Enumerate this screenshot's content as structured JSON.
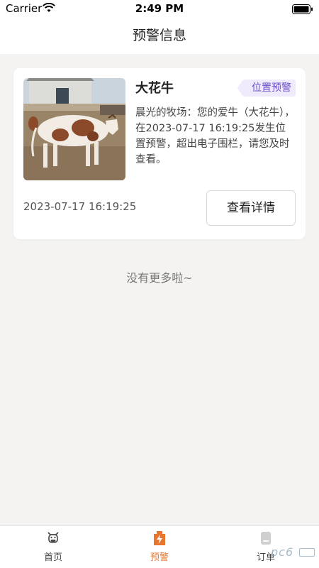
{
  "status_bar": {
    "carrier": "Carrier",
    "time": "2:49 PM",
    "wifi_icon": "wifi-icon",
    "battery_icon": "battery-icon"
  },
  "nav": {
    "title": "预警信息"
  },
  "alerts": [
    {
      "cow_name": "大花牛",
      "tag": "位置预警",
      "description": "晨光的牧场：您的爱牛（大花牛），在2023-07-17 16:19:25发生位置预警，超出电子围栏，请您及时查看。",
      "time": "2023-07-17 16:19:25",
      "detail_button": "查看详情",
      "photo_icon": "cow-photo"
    }
  ],
  "list_end": "没有更多啦~",
  "tab_bar": {
    "tabs": [
      {
        "label": "首页",
        "icon": "cow-head-icon",
        "active": false
      },
      {
        "label": "预警",
        "icon": "alert-bolt-icon",
        "active": true
      },
      {
        "label": "订单",
        "icon": "order-icon",
        "active": false
      }
    ]
  },
  "watermark": {
    "text": "pc6",
    "icon": "watermark-logo"
  },
  "colors": {
    "accent": "#e8762e",
    "tag_bg": "#efeafc",
    "tag_text": "#6b4fc9",
    "background": "#f4f3f2"
  }
}
